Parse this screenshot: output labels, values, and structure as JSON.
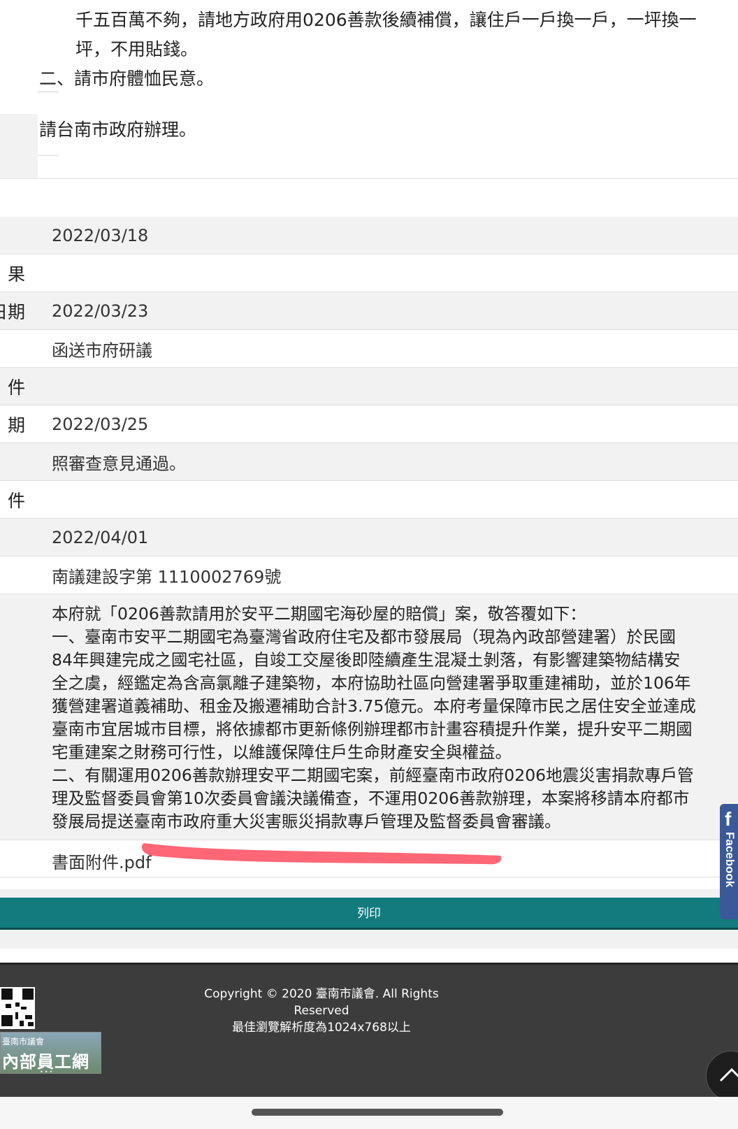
{
  "top": {
    "line1": "千五百萬不夠，請地方政府用0206善款後續補償，讓住戶一戶換一戶，一坪換一",
    "line2": "坪，不用貼錢。",
    "item2": "二、請市府體恤民意。",
    "note": "請台南市政府辦理。"
  },
  "rows": [
    {
      "label": "",
      "value": ""
    },
    {
      "label": "",
      "value": "2022/03/18"
    },
    {
      "label": "果",
      "value": ""
    },
    {
      "label": "日期",
      "value": "2022/03/23"
    },
    {
      "label": "",
      "value": "函送市府研議"
    },
    {
      "label": "件",
      "value": ""
    },
    {
      "label": "期",
      "value": "2022/03/25"
    },
    {
      "label": "",
      "value": "照審查意見通過。"
    },
    {
      "label": "件",
      "value": ""
    },
    {
      "label": "",
      "value": "2022/04/01"
    },
    {
      "label": "",
      "value": "南議建設字第 1110002769號"
    }
  ],
  "reply": {
    "lines": [
      "本府就「0206善款請用於安平二期國宅海砂屋的賠償」案，敬答覆如下：",
      "一、臺南市安平二期國宅為臺灣省政府住宅及都市發展局（現為內政部營建署）於民國",
      "84年興建完成之國宅社區，自竣工交屋後即陸續產生混凝土剝落，有影響建築物結構安",
      "全之虞，經鑑定為含高氯離子建築物，本府協助社區向營建署爭取重建補助，並於106年",
      "獲營建署道義補助、租金及搬遷補助合計3.75億元。本府考量保障市民之居住安全並達成",
      "臺南市宜居城市目標，將依據都市更新條例辦理都市計畫容積提升作業，提升安平二期國",
      "宅重建案之財務可行性，以維護保障住戶生命財產安全與權益。",
      "二、有關運用0206善款辦理安平二期國宅案，前經臺南市政府0206地震災害捐款專戶管",
      "理及監督委員會第10次委員會議決議備查，不運用0206善款辦理，本案將移請本府都市",
      "發展局提送臺南市政府重大災害賑災捐款專戶管理及監督委員會審議。"
    ]
  },
  "attachment": {
    "label": "書面附件.pdf"
  },
  "print_label": "列印",
  "footer": {
    "copyright_line1": "Copyright © 2020 臺南市議會. All Rights",
    "copyright_line2": "Reserved",
    "resolution": "最佳瀏覽解析度為1024x768以上",
    "banner_small": "臺南市議會",
    "banner_big": "內部員工網",
    "banner_dots": "•••"
  },
  "facebook_tab": {
    "letter": "f",
    "text": "Facebook"
  },
  "colors": {
    "print_button": "#137b7e",
    "footer_bg": "#3c3c3c",
    "facebook": "#3b5998",
    "annotation": "#ff5a6a"
  },
  "icons": {
    "back_to_top": "chevron-up-icon",
    "qr": "qr-code-icon"
  }
}
